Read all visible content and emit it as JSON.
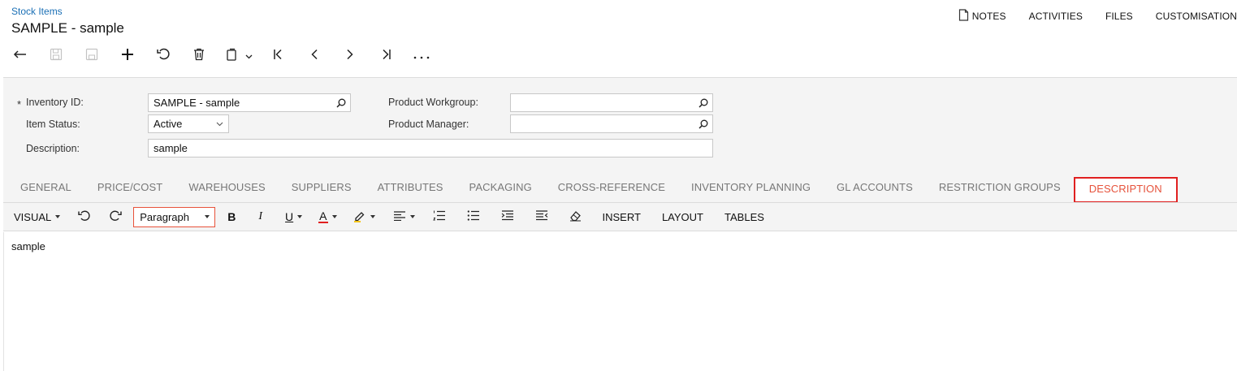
{
  "header": {
    "breadcrumb": "Stock Items",
    "title": "SAMPLE - sample",
    "links": [
      {
        "label": "NOTES",
        "icon": "note-icon"
      },
      {
        "label": "ACTIVITIES"
      },
      {
        "label": "FILES"
      },
      {
        "label": "CUSTOMISATION"
      }
    ]
  },
  "toolbar": {
    "buttons": [
      "back-icon",
      "save-and-close-icon",
      "save-icon",
      "add-icon",
      "undo-icon",
      "delete-icon",
      "copy-paste-icon",
      "first-record-icon",
      "previous-icon",
      "next-icon",
      "last-record-icon",
      "more-icon"
    ]
  },
  "form": {
    "inventory_id": {
      "label": "Inventory ID:",
      "required_mark": "*",
      "value": "SAMPLE - sample"
    },
    "item_status": {
      "label": "Item Status:",
      "value": "Active"
    },
    "description": {
      "label": "Description:",
      "value": "sample"
    },
    "product_workgroup": {
      "label": "Product Workgroup:",
      "value": ""
    },
    "product_manager": {
      "label": "Product Manager:",
      "value": ""
    }
  },
  "tabs": [
    "GENERAL",
    "PRICE/COST",
    "WAREHOUSES",
    "SUPPLIERS",
    "ATTRIBUTES",
    "PACKAGING",
    "CROSS-REFERENCE",
    "INVENTORY PLANNING",
    "GL ACCOUNTS",
    "RESTRICTION GROUPS",
    "DESCRIPTION"
  ],
  "active_tab": "DESCRIPTION",
  "editor": {
    "mode": "VISUAL",
    "paragraph": "Paragraph",
    "insert": "INSERT",
    "layout": "LAYOUT",
    "tables": "TABLES",
    "content": "sample"
  },
  "colors": {
    "accent_link": "#1a6fb5",
    "active_tab_text": "#e6533c",
    "highlight_border": "#e02020"
  }
}
